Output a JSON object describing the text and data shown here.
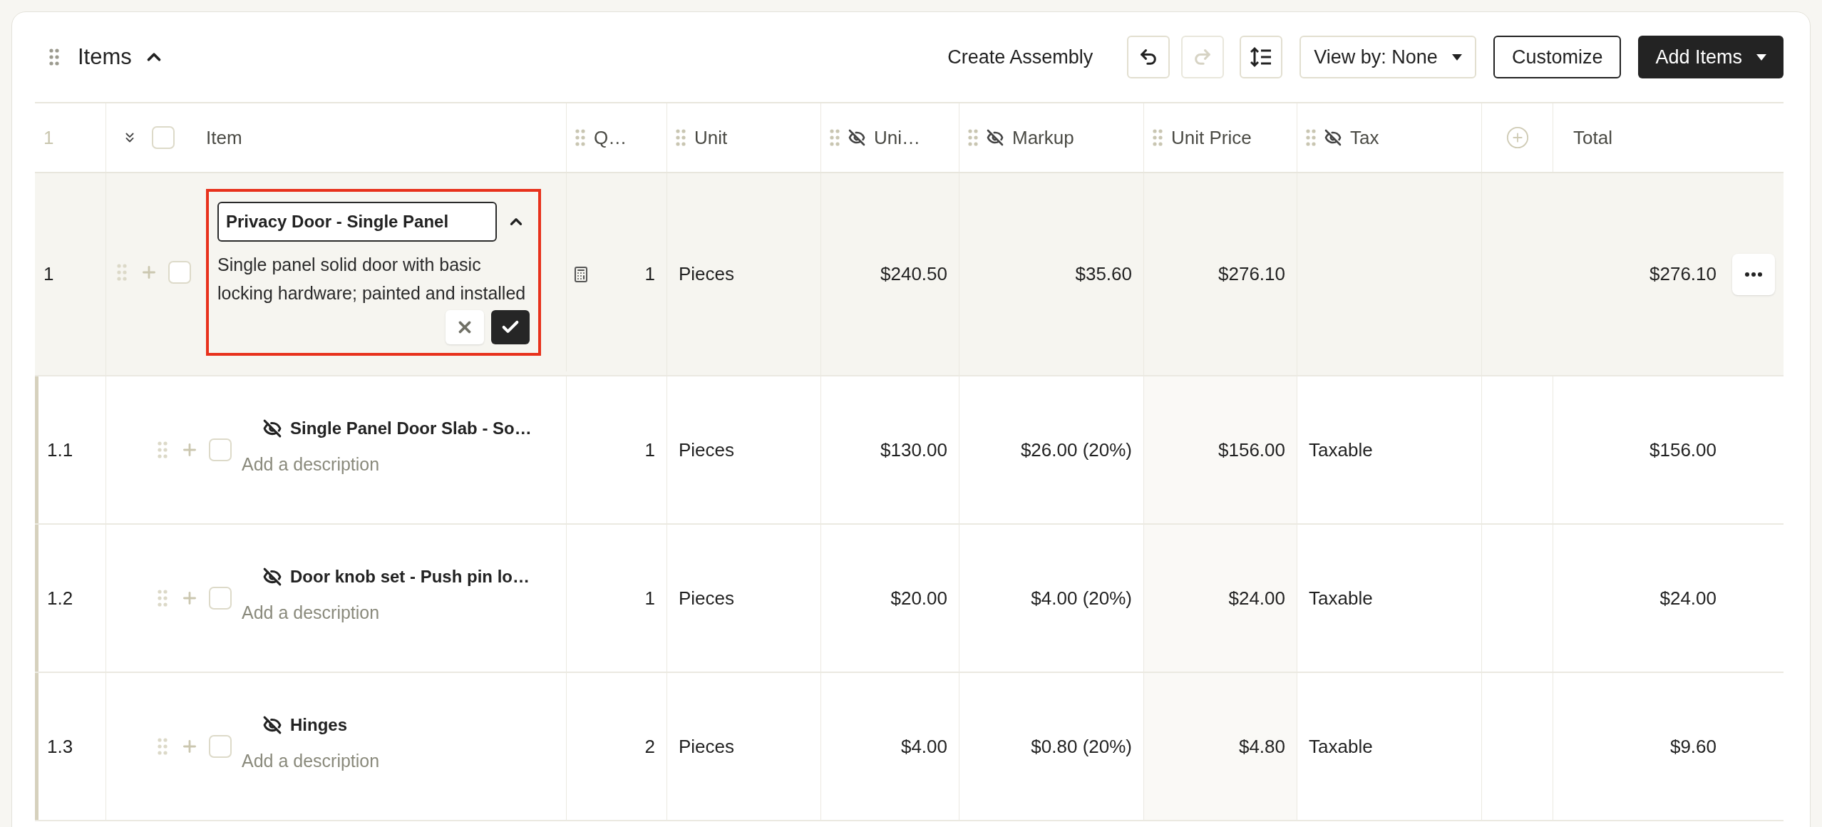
{
  "section": {
    "title": "Items",
    "expanded": true
  },
  "toolbar": {
    "create_assembly": "Create Assembly",
    "undo": {
      "disabled": false
    },
    "redo": {
      "disabled": true
    },
    "view_by": "View by: None",
    "customize": "Customize",
    "add_items": "Add Items"
  },
  "table": {
    "corner_label": "1",
    "header_checkbox": {
      "checked": false
    },
    "columns": [
      {
        "kind": "item",
        "label": "Item"
      },
      {
        "kind": "qty",
        "label": "Q…",
        "hidden": false
      },
      {
        "kind": "unit",
        "label": "Unit",
        "hidden": false
      },
      {
        "kind": "unit_cost",
        "label": "Uni…",
        "hidden": true
      },
      {
        "kind": "markup",
        "label": "Markup",
        "hidden": true
      },
      {
        "kind": "unit_price",
        "label": "Unit Price",
        "hidden": false
      },
      {
        "kind": "tax",
        "label": "Tax",
        "hidden": true
      },
      {
        "kind": "add"
      },
      {
        "kind": "total",
        "label": "Total"
      }
    ],
    "rows": [
      {
        "number": "1",
        "kind": "assembly",
        "checked": false,
        "editing": true,
        "hidden": false,
        "name": "Privacy Door - Single Panel",
        "description": "Single panel solid door with basic locking hardware; painted and installed",
        "qty": "1",
        "unit": "Pieces",
        "unit_cost": "$240.50",
        "markup": "$35.60",
        "unit_price": "$276.10",
        "total": "$276.10",
        "children": [
          {
            "number": "1.1",
            "kind": "item",
            "checked": false,
            "editing": false,
            "hidden": true,
            "name": "Single Panel Door Slab - So…",
            "placeholder": "Add a description",
            "qty": "1",
            "unit": "Pieces",
            "unit_cost": "$130.00",
            "markup": "$26.00 (20%)",
            "unit_price": "$156.00",
            "tax": "Taxable",
            "total": "$156.00"
          },
          {
            "number": "1.2",
            "kind": "item",
            "checked": false,
            "editing": false,
            "hidden": true,
            "name": "Door knob set - Push pin lo…",
            "placeholder": "Add a description",
            "qty": "1",
            "unit": "Pieces",
            "unit_cost": "$20.00",
            "markup": "$4.00 (20%)",
            "unit_price": "$24.00",
            "tax": "Taxable",
            "total": "$24.00"
          },
          {
            "number": "1.3",
            "kind": "item",
            "checked": false,
            "editing": false,
            "hidden": true,
            "name": "Hinges",
            "placeholder": "Add a description",
            "qty": "2",
            "unit": "Pieces",
            "unit_cost": "$4.00",
            "markup": "$0.80 (20%)",
            "unit_price": "$4.80",
            "tax": "Taxable",
            "total": "$9.60"
          }
        ]
      }
    ]
  }
}
